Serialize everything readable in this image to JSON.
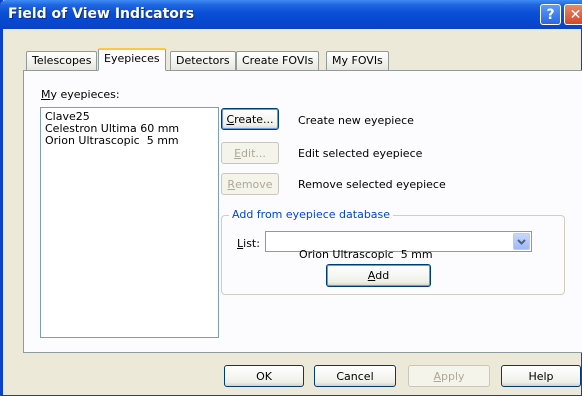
{
  "window": {
    "title": "Field of View Indicators",
    "help_glyph": "?",
    "close_glyph": "✕"
  },
  "tabs": [
    {
      "label": "Telescopes",
      "active": false
    },
    {
      "label": "Eyepieces",
      "active": true
    },
    {
      "label": "Detectors",
      "active": false
    },
    {
      "label": "Create FOVIs",
      "active": false
    },
    {
      "label": "My FOVIs",
      "active": false
    }
  ],
  "eyepieces": {
    "label_mnemonic": "M",
    "label_rest": "y eyepieces:",
    "items": [
      "Clave25",
      "Celestron Ultima 60 mm",
      "Orion Ultrascopic  5 mm"
    ]
  },
  "actions": {
    "create": {
      "mnemonic": "C",
      "rest": "reate...",
      "desc": "Create new eyepiece",
      "enabled": true
    },
    "edit": {
      "mnemonic": "E",
      "rest": "dit...",
      "desc": "Edit selected eyepiece",
      "enabled": false
    },
    "remove": {
      "mnemonic": "R",
      "rest": "emove",
      "desc": "Remove selected eyepiece",
      "enabled": false
    }
  },
  "database": {
    "group_title": "Add from eyepiece database",
    "list_label_mnemonic": "L",
    "list_label_rest": "ist:",
    "selected": "Orion Ultrascopic  5 mm",
    "add_mnemonic": "A",
    "add_rest": "dd"
  },
  "footer": {
    "ok": "OK",
    "cancel": "Cancel",
    "apply_mnemonic": "A",
    "apply_rest": "pply",
    "help": "Help"
  }
}
